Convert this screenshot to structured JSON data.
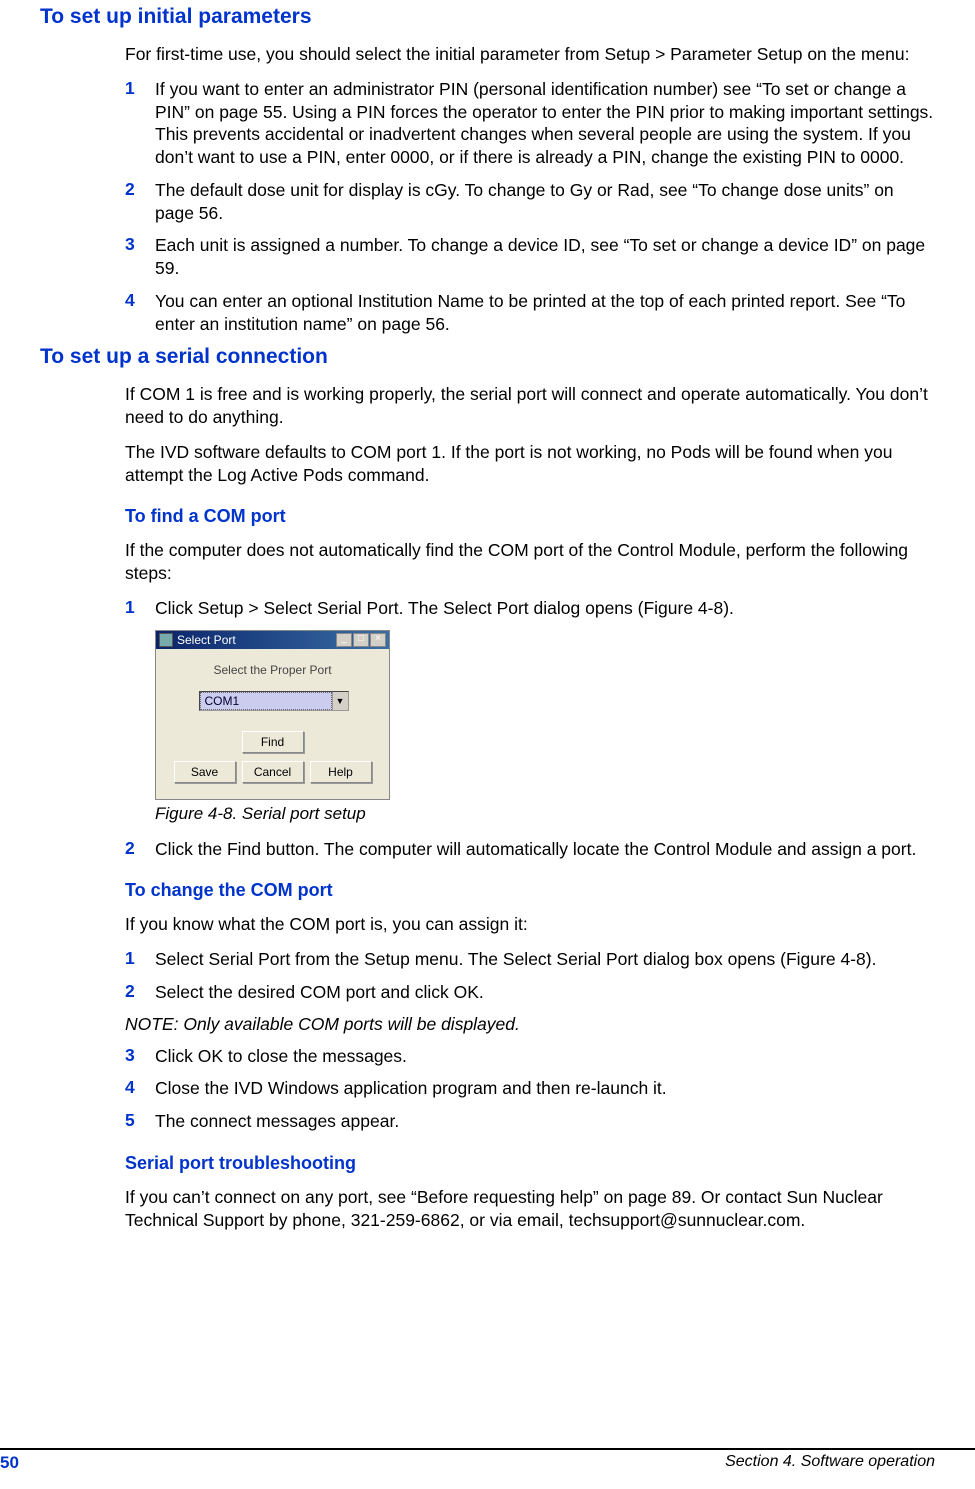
{
  "h1": "To set up initial parameters",
  "p1": "For first-time use, you should select the initial parameter from Setup > Parameter Setup on the menu:",
  "s1": {
    "i1": {
      "n": "1",
      "t": "If you want to enter an administrator PIN (personal identification number) see “To set or change a PIN” on page 55. Using a PIN forces the operator to enter the PIN prior to making important settings. This prevents accidental or inadvertent changes when several people are using the system. If you don’t want to use a PIN, enter 0000, or if there is already a PIN, change the existing PIN to 0000."
    },
    "i2": {
      "n": "2",
      "t": "The default dose unit for display is cGy. To change to Gy or Rad, see “To change dose units” on page 56."
    },
    "i3": {
      "n": "3",
      "t": "Each unit is assigned a number. To change a device ID, see “To set or change a device ID” on page 59."
    },
    "i4": {
      "n": "4",
      "t": "You can enter an optional Institution Name to be printed at the top of each printed report. See “To enter an institution name” on page 56."
    }
  },
  "h2": "To set up a serial connection",
  "p2": "If COM 1 is free and is working properly, the serial port will connect and operate automatically. You don’t need to do anything.",
  "p3": "The IVD software defaults to COM port 1. If the port is not working, no Pods will be found when you attempt the Log Active Pods command.",
  "h3": "To find a COM port",
  "p4": "If the computer does not automatically find the COM port of the Control Module, perform the following steps:",
  "s2": {
    "i1": {
      "n": "1",
      "t": "Click Setup > Select Serial Port. The Select Port dialog opens (Figure 4-8)."
    }
  },
  "dialog": {
    "title": "Select Port",
    "prompt": "Select the Proper Port",
    "combo_value": "COM1",
    "find": "Find",
    "save": "Save",
    "cancel": "Cancel",
    "help": "Help"
  },
  "figcap": "Figure 4-8. Serial port setup",
  "s2b": {
    "i2": {
      "n": "2",
      "t": "Click the Find button. The computer will automatically locate the Control Module and assign a port."
    }
  },
  "h4": "To change the COM port",
  "p5": "If you know what the COM port is, you can assign it:",
  "s3": {
    "i1": {
      "n": "1",
      "t": "Select Serial Port from the Setup menu. The Select Serial Port dialog box opens (Figure 4-8)."
    },
    "i2": {
      "n": "2",
      "t": "Select the desired COM port and click OK."
    }
  },
  "note": "NOTE: Only available COM ports will be displayed.",
  "s3b": {
    "i3": {
      "n": "3",
      "t": "Click OK to close the messages."
    },
    "i4": {
      "n": "4",
      "t": "Close the IVD Windows application program and then re-launch it."
    },
    "i5": {
      "n": "5",
      "t": "The connect messages appear."
    }
  },
  "h5": "Serial port troubleshooting",
  "p6": "If you can’t connect on any port, see “Before requesting help” on page 89. Or contact Sun Nuclear Technical Support by phone, 321-259-6862, or via email, techsupport@sunnuclear.com.",
  "footer": {
    "page": "50",
    "section": "Section 4. Software operation"
  }
}
